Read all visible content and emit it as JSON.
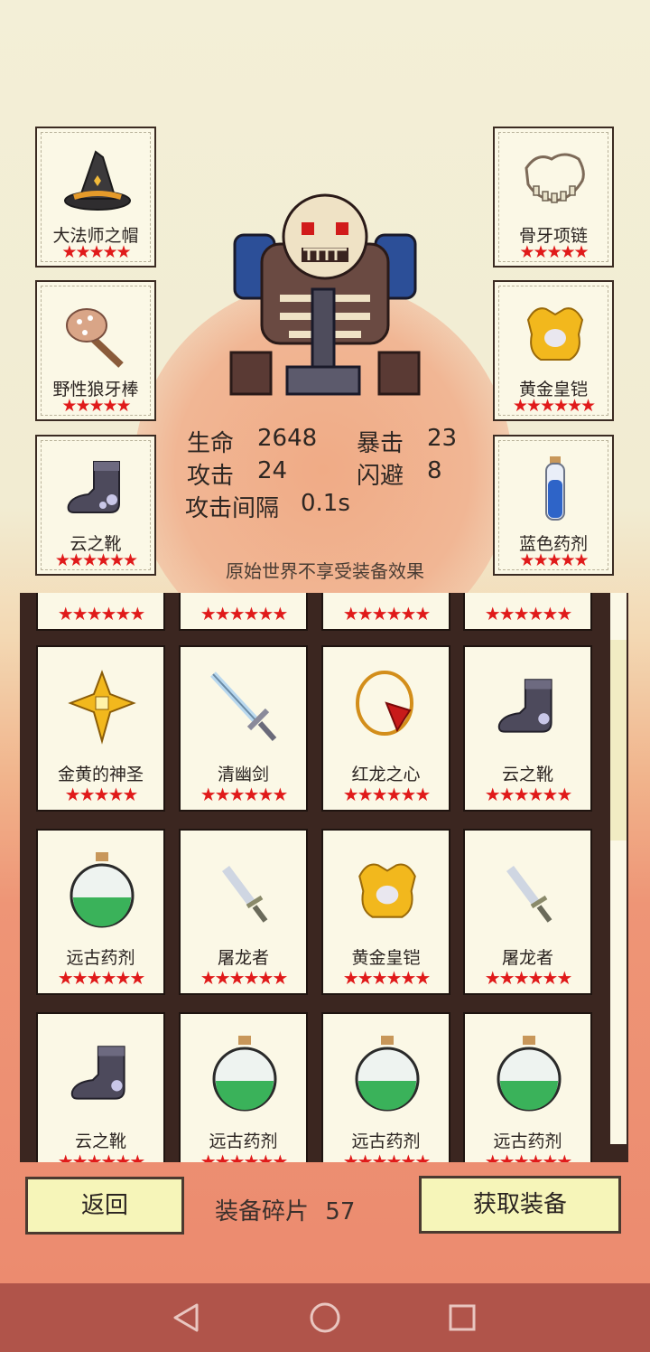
{
  "equipped_slots": [
    {
      "name": "大法师之帽",
      "stars": "★★★★★",
      "icon": "wizard-hat-icon"
    },
    {
      "name": "野性狼牙棒",
      "stars": "★★★★★",
      "icon": "wolf-club-icon"
    },
    {
      "name": "云之靴",
      "stars": "★★★★★★",
      "icon": "cloud-boots-icon"
    },
    {
      "name": "骨牙项链",
      "stars": "★★★★★",
      "icon": "bone-necklace-icon"
    },
    {
      "name": "黄金皇铠",
      "stars": "★★★★★★",
      "icon": "golden-armor-icon"
    },
    {
      "name": "蓝色药剂",
      "stars": "★★★★★",
      "icon": "blue-potion-icon"
    }
  ],
  "hero": {
    "icon": "skeleton-hero-icon"
  },
  "stats": {
    "hp_label": "生命",
    "hp_value": "2648",
    "crit_label": "暴击",
    "crit_value": "23",
    "atk_label": "攻击",
    "atk_value": "24",
    "dodge_label": "闪避",
    "dodge_value": "8",
    "interval_label": "攻击间隔",
    "interval_value": "0.1s"
  },
  "notice": "原始世界不享受装备效果",
  "inventory": {
    "top_partial_stars": "★★★★★★",
    "rows": [
      [
        {
          "name": "金黄的神圣",
          "stars": "★★★★★",
          "icon": "golden-holy-cross-icon"
        },
        {
          "name": "清幽剑",
          "stars": "★★★★★★",
          "icon": "sword-icon"
        },
        {
          "name": "红龙之心",
          "stars": "★★★★★★",
          "icon": "red-dragon-heart-icon"
        },
        {
          "name": "云之靴",
          "stars": "★★★★★★",
          "icon": "cloud-boots-icon"
        }
      ],
      [
        {
          "name": "远古药剂",
          "stars": "★★★★★★",
          "icon": "green-potion-icon"
        },
        {
          "name": "屠龙者",
          "stars": "★★★★★★",
          "icon": "dagger-icon"
        },
        {
          "name": "黄金皇铠",
          "stars": "★★★★★★",
          "icon": "golden-armor-icon"
        },
        {
          "name": "屠龙者",
          "stars": "★★★★★★",
          "icon": "dagger-icon"
        }
      ],
      [
        {
          "name": "云之靴",
          "stars": "★★★★★★",
          "icon": "cloud-boots-icon"
        },
        {
          "name": "远古药剂",
          "stars": "★★★★★★",
          "icon": "green-potion-icon"
        },
        {
          "name": "远古药剂",
          "stars": "★★★★★★",
          "icon": "green-potion-icon"
        },
        {
          "name": "远古药剂",
          "stars": "★★★★★★",
          "icon": "green-potion-icon"
        }
      ]
    ]
  },
  "footer": {
    "back_label": "返回",
    "fragments_label": "装备碎片",
    "fragments_value": "57",
    "get_label": "获取装备"
  },
  "colors": {
    "star": "#e01a1a",
    "button": "#f6f5b9",
    "frame": "#3b2620",
    "navbar": "#b0544a"
  }
}
